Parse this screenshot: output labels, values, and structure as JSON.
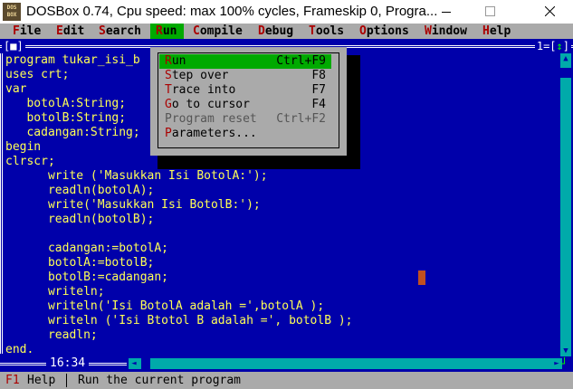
{
  "window": {
    "title": "DOSBox 0.74, Cpu speed: max 100% cycles, Frameskip  0, Progra...",
    "icon_text_top": "DOS",
    "icon_text_bottom": "BOX"
  },
  "menubar": {
    "items": [
      {
        "hot": "F",
        "rest": "ile"
      },
      {
        "hot": "E",
        "rest": "dit"
      },
      {
        "hot": "S",
        "rest": "earch"
      },
      {
        "hot": "R",
        "rest": "un"
      },
      {
        "hot": "C",
        "rest": "ompile"
      },
      {
        "hot": "D",
        "rest": "ebug"
      },
      {
        "hot": "T",
        "rest": "ools"
      },
      {
        "hot": "O",
        "rest": "ptions"
      },
      {
        "hot": "W",
        "rest": "indow"
      },
      {
        "hot": "H",
        "rest": "elp"
      }
    ]
  },
  "editor": {
    "close_box": "[■]",
    "right_box_num": "1",
    "right_box_arrow": "↕",
    "position": "16:34",
    "code_lines": [
      "program tukar_isi_b",
      "uses crt;",
      "var",
      "   botolA:String;",
      "   botolB:String;",
      "   cadangan:String;",
      "begin",
      "clrscr;",
      "      write ('Masukkan Isi BotolA:');",
      "      readln(botolA);",
      "      write('Masukkan Isi BotolB:');",
      "      readln(botolB);",
      "",
      "      cadangan:=botolA;",
      "      botolA:=botolB;",
      "      botolB:=cadangan;",
      "      writeln;",
      "      writeln('Isi BotolA adalah =',botolA );",
      "      writeln ('Isi Btotol B adalah =', botolB );",
      "      readln;",
      "end."
    ]
  },
  "run_menu": {
    "items": [
      {
        "hot": "R",
        "rest": "un",
        "shortcut": "Ctrl+F9"
      },
      {
        "hot": "S",
        "rest": "tep over",
        "shortcut": "F8"
      },
      {
        "hot": "T",
        "rest": "race into",
        "shortcut": "F7"
      },
      {
        "hot": "G",
        "rest": "o to cursor",
        "shortcut": "F4"
      },
      {
        "hot": "",
        "rest": "Program reset",
        "shortcut": "Ctrl+F2"
      },
      {
        "hot": "P",
        "rest": "arameters...",
        "shortcut": ""
      }
    ]
  },
  "statusbar": {
    "key": "F1",
    "key_label": "Help",
    "hint": "Run the current program"
  },
  "colors": {
    "dos_blue": "#0000aa",
    "menu_gray": "#aaaaaa",
    "highlight_green": "#00aa00",
    "code_yellow": "#ffff55",
    "hotkey_red": "#aa0000",
    "scroll_cyan": "#00aaaa"
  }
}
